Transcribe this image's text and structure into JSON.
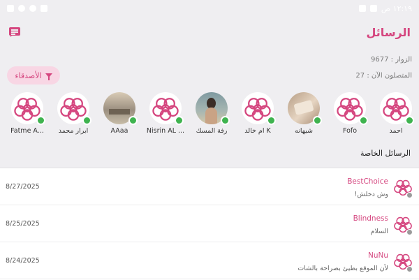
{
  "status_bar": {
    "time": "١٢:١٩ ص"
  },
  "header": {
    "title": "الرسائل",
    "chat_icon": "chat-bubble-icon"
  },
  "stats": {
    "visitors": "الزوار : 9677",
    "online": "المتصلون الآن : 27"
  },
  "filter": {
    "label": "الأصدقاء",
    "icon": "funnel-icon"
  },
  "friends": [
    {
      "name": "احمد",
      "online": true,
      "avatar": "flower"
    },
    {
      "name": "Fofo",
      "online": true,
      "avatar": "flower"
    },
    {
      "name": "شيهانه",
      "online": true,
      "avatar": "photo-hand"
    },
    {
      "name": "ام خالد K",
      "online": true,
      "avatar": "flower"
    },
    {
      "name": "رفة المسك",
      "online": true,
      "avatar": "photo-woman"
    },
    {
      "name": "Nisrin AL ...",
      "online": true,
      "avatar": "flower"
    },
    {
      "name": "AAaa",
      "online": true,
      "avatar": "photo-room"
    },
    {
      "name": "ابرار محمد",
      "online": true,
      "avatar": "flower"
    },
    {
      "name": "Fatme A...",
      "online": true,
      "avatar": "flower"
    },
    {
      "name": "",
      "online": false,
      "avatar": "flower"
    }
  ],
  "section_title": "الرسائل الخاصة",
  "messages": [
    {
      "sender": "BestChoice",
      "preview": "وش دخلش!",
      "date": "8/27/2025"
    },
    {
      "sender": "Blindness",
      "preview": "السلام",
      "date": "8/25/2025"
    },
    {
      "sender": "NuNu",
      "preview": "لأن الموقع بطيئ بصراحة بالشات",
      "date": "8/24/2025"
    }
  ],
  "colors": {
    "accent": "#d5467f",
    "online": "#3fb34f",
    "offline": "#9b9b9b",
    "chip_bg": "#f8d6e4"
  }
}
